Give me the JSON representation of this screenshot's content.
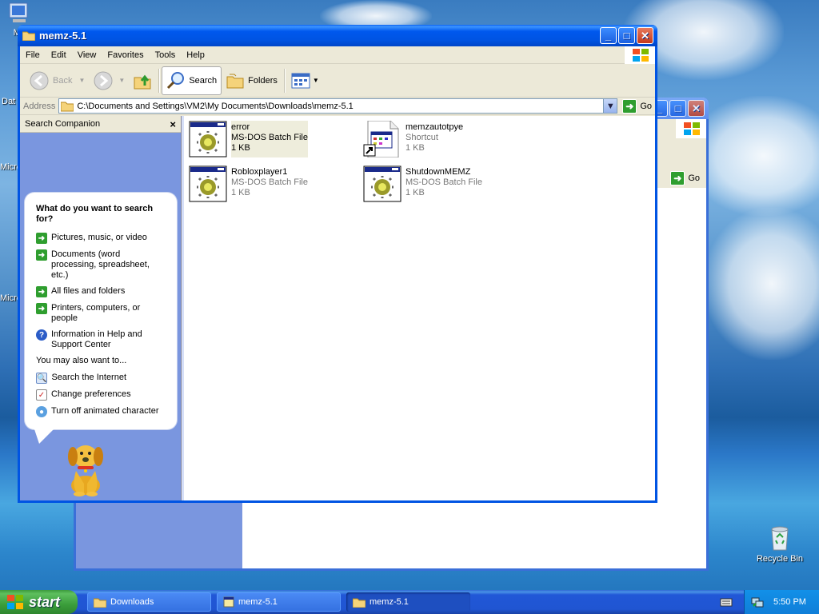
{
  "desktop": {
    "icons": [
      {
        "label": "My",
        "icon": "my-computer-icon"
      },
      {
        "label": "Dat",
        "icon": "data-icon"
      },
      {
        "label": "Micro",
        "icon": "microsoft-icon"
      },
      {
        "label": "Micro",
        "icon": "microsoft-icon"
      },
      {
        "label": "Recycle Bin",
        "icon": "recycle-bin-icon"
      }
    ]
  },
  "back_window": {
    "go_label": "Go"
  },
  "front_window": {
    "title": "memz-5.1",
    "menu": [
      "File",
      "Edit",
      "View",
      "Favorites",
      "Tools",
      "Help"
    ],
    "toolbar": {
      "back": "Back",
      "search": "Search",
      "folders": "Folders"
    },
    "address": {
      "label": "Address",
      "value": "C:\\Documents and Settings\\VM2\\My Documents\\Downloads\\memz-5.1",
      "go": "Go"
    },
    "search_companion": {
      "header": "Search Companion",
      "question": "What do you want to search for?",
      "options": [
        "Pictures, music, or video",
        "Documents (word processing, spreadsheet, etc.)",
        "All files and folders",
        "Printers, computers, or people",
        "Information in Help and Support Center"
      ],
      "also_label": "You may also want to...",
      "also": [
        "Search the Internet",
        "Change preferences",
        "Turn off animated character"
      ]
    },
    "files": [
      {
        "name": "error",
        "type": "MS-DOS Batch File",
        "size": "1 KB",
        "icon": "batch-file-icon"
      },
      {
        "name": "memzautotpye",
        "type": "Shortcut",
        "size": "1 KB",
        "icon": "shortcut-icon"
      },
      {
        "name": "Robloxplayer1",
        "type": "MS-DOS Batch File",
        "size": "1 KB",
        "icon": "batch-file-icon"
      },
      {
        "name": "ShutdownMEMZ",
        "type": "MS-DOS Batch File",
        "size": "1 KB",
        "icon": "batch-file-icon"
      }
    ]
  },
  "taskbar": {
    "start": "start",
    "tasks": [
      "Downloads",
      "memz-5.1",
      "memz-5.1"
    ],
    "clock": "5:50 PM"
  },
  "colors": {
    "xp_blue": "#0054e3",
    "pane_blue": "#7a96df",
    "start_green": "#3b9e3b"
  }
}
